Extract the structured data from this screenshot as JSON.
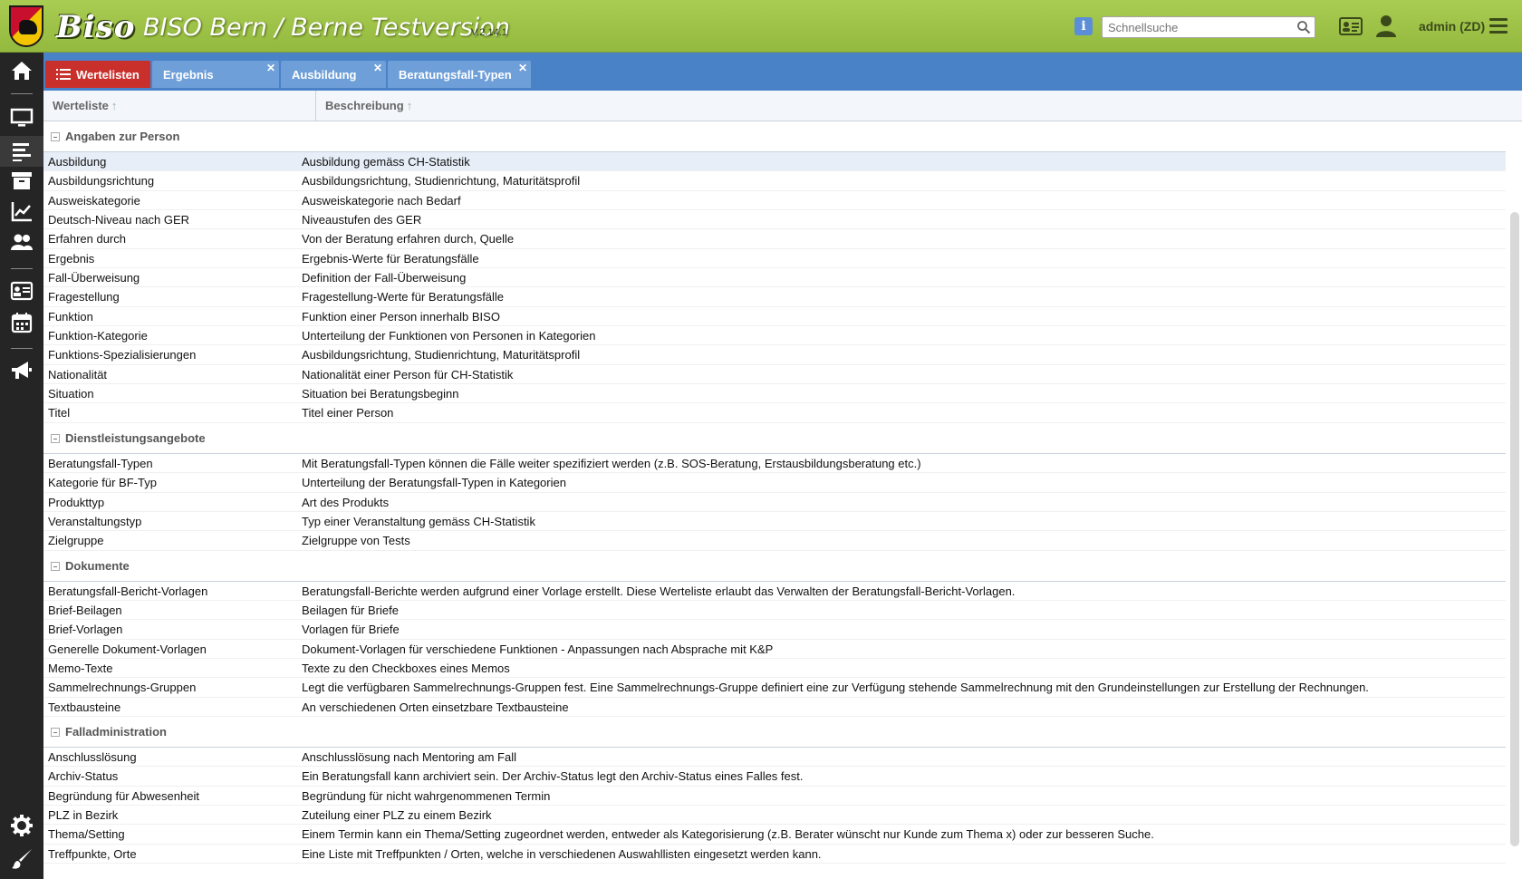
{
  "header": {
    "app_title": "BISO Bern / Berne Testversion",
    "logo_text": "Biso",
    "version": "V.2.14.1",
    "search_placeholder": "Schnellsuche",
    "user_label": "admin (ZD)"
  },
  "sidebar": {
    "items": [
      "home-icon",
      "monitor-icon",
      "list-icon",
      "archive-icon",
      "chart-icon",
      "users-icon",
      "contact-card-icon",
      "calendar-icon",
      "megaphone-icon",
      "gear-icon",
      "brush-icon"
    ]
  },
  "tabs": [
    {
      "label": "Wertelisten",
      "active": true,
      "closable": false
    },
    {
      "label": "Ergebnis",
      "active": false,
      "closable": true
    },
    {
      "label": "Ausbildung",
      "active": false,
      "closable": true
    },
    {
      "label": "Beratungsfall-Typen",
      "active": false,
      "closable": true
    }
  ],
  "grid": {
    "columns": [
      "Werteliste",
      "Beschreibung"
    ],
    "groups": [
      {
        "title": "Angaben zur Person",
        "rows": [
          [
            "Ausbildung",
            "Ausbildung gemäss CH-Statistik"
          ],
          [
            "Ausbildungsrichtung",
            "Ausbildungsrichtung, Studienrichtung, Maturitätsprofil"
          ],
          [
            "Ausweiskategorie",
            "Ausweiskategorie nach Bedarf"
          ],
          [
            "Deutsch-Niveau nach GER",
            "Niveaustufen des GER"
          ],
          [
            "Erfahren durch",
            "Von der Beratung erfahren durch, Quelle"
          ],
          [
            "Ergebnis",
            "Ergebnis-Werte für Beratungsfälle"
          ],
          [
            "Fall-Überweisung",
            "Definition der Fall-Überweisung"
          ],
          [
            "Fragestellung",
            "Fragestellung-Werte für Beratungsfälle"
          ],
          [
            "Funktion",
            "Funktion einer Person innerhalb BISO"
          ],
          [
            "Funktion-Kategorie",
            "Unterteilung der Funktionen von Personen in Kategorien"
          ],
          [
            "Funktions-Spezialisierungen",
            "Ausbildungsrichtung, Studienrichtung, Maturitätsprofil"
          ],
          [
            "Nationalität",
            "Nationalität einer Person für CH-Statistik"
          ],
          [
            "Situation",
            "Situation bei Beratungsbeginn"
          ],
          [
            "Titel",
            "Titel einer Person"
          ]
        ]
      },
      {
        "title": "Dienstleistungsangebote",
        "rows": [
          [
            "Beratungsfall-Typen",
            "Mit Beratungsfall-Typen können die Fälle weiter spezifiziert werden (z.B. SOS-Beratung, Erstausbildungsberatung etc.)"
          ],
          [
            "Kategorie für BF-Typ",
            "Unterteilung der Beratungsfall-Typen in Kategorien"
          ],
          [
            "Produkttyp",
            "Art des Produkts"
          ],
          [
            "Veranstaltungstyp",
            "Typ einer Veranstaltung gemäss CH-Statistik"
          ],
          [
            "Zielgruppe",
            "Zielgruppe von Tests"
          ]
        ]
      },
      {
        "title": "Dokumente",
        "rows": [
          [
            "Beratungsfall-Bericht-Vorlagen",
            "Beratungsfall-Berichte werden aufgrund einer Vorlage erstellt. Diese Werteliste erlaubt das Verwalten der Beratungsfall-Bericht-Vorlagen."
          ],
          [
            "Brief-Beilagen",
            "Beilagen für Briefe"
          ],
          [
            "Brief-Vorlagen",
            "Vorlagen für Briefe"
          ],
          [
            "Generelle Dokument-Vorlagen",
            "Dokument-Vorlagen für verschiedene Funktionen - Anpassungen nach Absprache mit K&P"
          ],
          [
            "Memo-Texte",
            "Texte zu den Checkboxes eines Memos"
          ],
          [
            "Sammelrechnungs-Gruppen",
            "Legt die verfügbaren Sammelrechnungs-Gruppen fest. Eine Sammelrechnungs-Gruppe definiert eine zur Verfügung stehende Sammelrechnung mit den Grundeinstellungen zur Erstellung der Rechnungen."
          ],
          [
            "Textbausteine",
            "An verschiedenen Orten einsetzbare Textbausteine"
          ]
        ]
      },
      {
        "title": "Falladministration",
        "rows": [
          [
            "Anschlusslösung",
            "Anschlusslösung nach Mentoring am Fall"
          ],
          [
            "Archiv-Status",
            "Ein Beratungsfall kann archiviert sein. Der Archiv-Status legt den Archiv-Status eines Falles fest."
          ],
          [
            "Begründung für Abwesenheit",
            "Begründung für nicht wahrgenommenen Termin"
          ],
          [
            "PLZ in Bezirk",
            "Zuteilung einer PLZ zu einem Bezirk"
          ],
          [
            "Thema/Setting",
            "Einem Termin kann ein Thema/Setting zugeordnet werden, entweder als Kategorisierung (z.B. Berater wünscht nur Kunde zum Thema x) oder zur besseren Suche."
          ],
          [
            "Treffpunkte, Orte",
            "Eine Liste mit Treffpunkten / Orten, welche in verschiedenen Auswahllisten eingesetzt werden kann."
          ]
        ]
      }
    ]
  }
}
